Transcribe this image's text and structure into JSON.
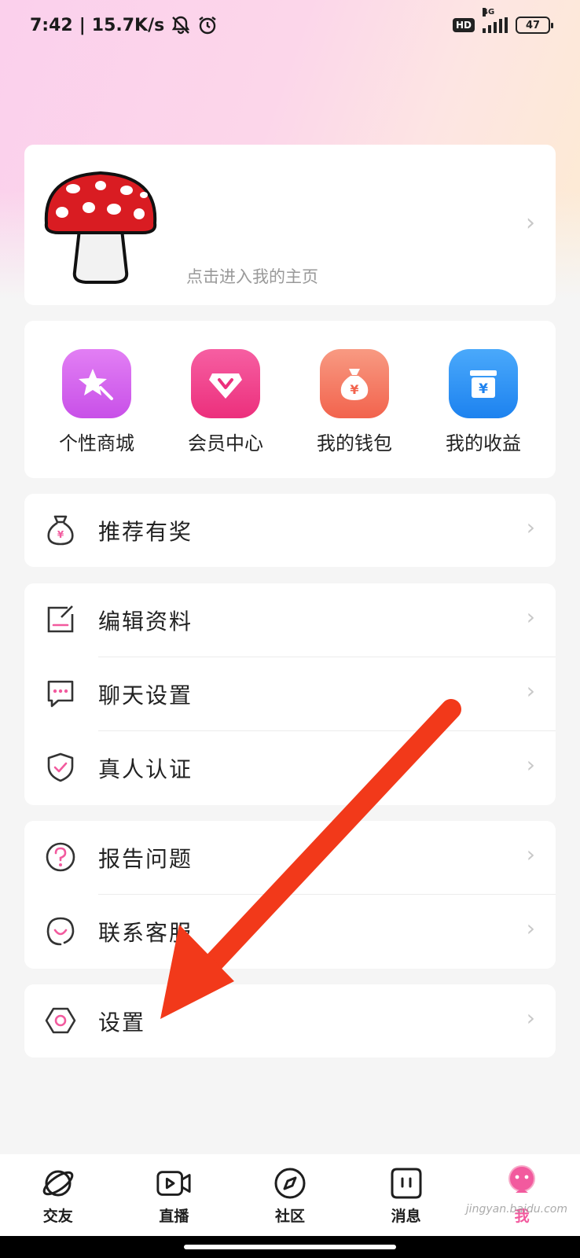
{
  "status_bar": {
    "time": "7:42",
    "separator": "|",
    "speed": "15.7K/s",
    "hd": "HD",
    "network": "4G",
    "battery": "47"
  },
  "profile": {
    "hint": "点击进入我的主页",
    "avatar_icon": "mushroom-avatar"
  },
  "features": [
    {
      "label": "个性商城",
      "icon": "star-wand-icon",
      "color": "#d86bf0"
    },
    {
      "label": "会员中心",
      "icon": "vip-diamond-icon",
      "color": "#f2468f"
    },
    {
      "label": "我的钱包",
      "icon": "money-bag-icon",
      "color": "#f47a66"
    },
    {
      "label": "我的收益",
      "icon": "earnings-box-icon",
      "color": "#2f93f5"
    }
  ],
  "menu": {
    "referral": "推荐有奖",
    "edit_profile": "编辑资料",
    "chat_settings": "聊天设置",
    "verification": "真人认证",
    "report": "报告问题",
    "support": "联系客服",
    "settings": "设置"
  },
  "nav": [
    {
      "label": "交友",
      "icon": "planet-icon"
    },
    {
      "label": "直播",
      "icon": "video-camera-icon"
    },
    {
      "label": "社区",
      "icon": "compass-icon"
    },
    {
      "label": "消息",
      "icon": "message-icon"
    },
    {
      "label": "我",
      "icon": "profile-avatar-icon"
    }
  ],
  "colors": {
    "accent": "#f25a9e",
    "arrow": "#f2391a"
  },
  "watermark": "jingyan.baidu.com"
}
